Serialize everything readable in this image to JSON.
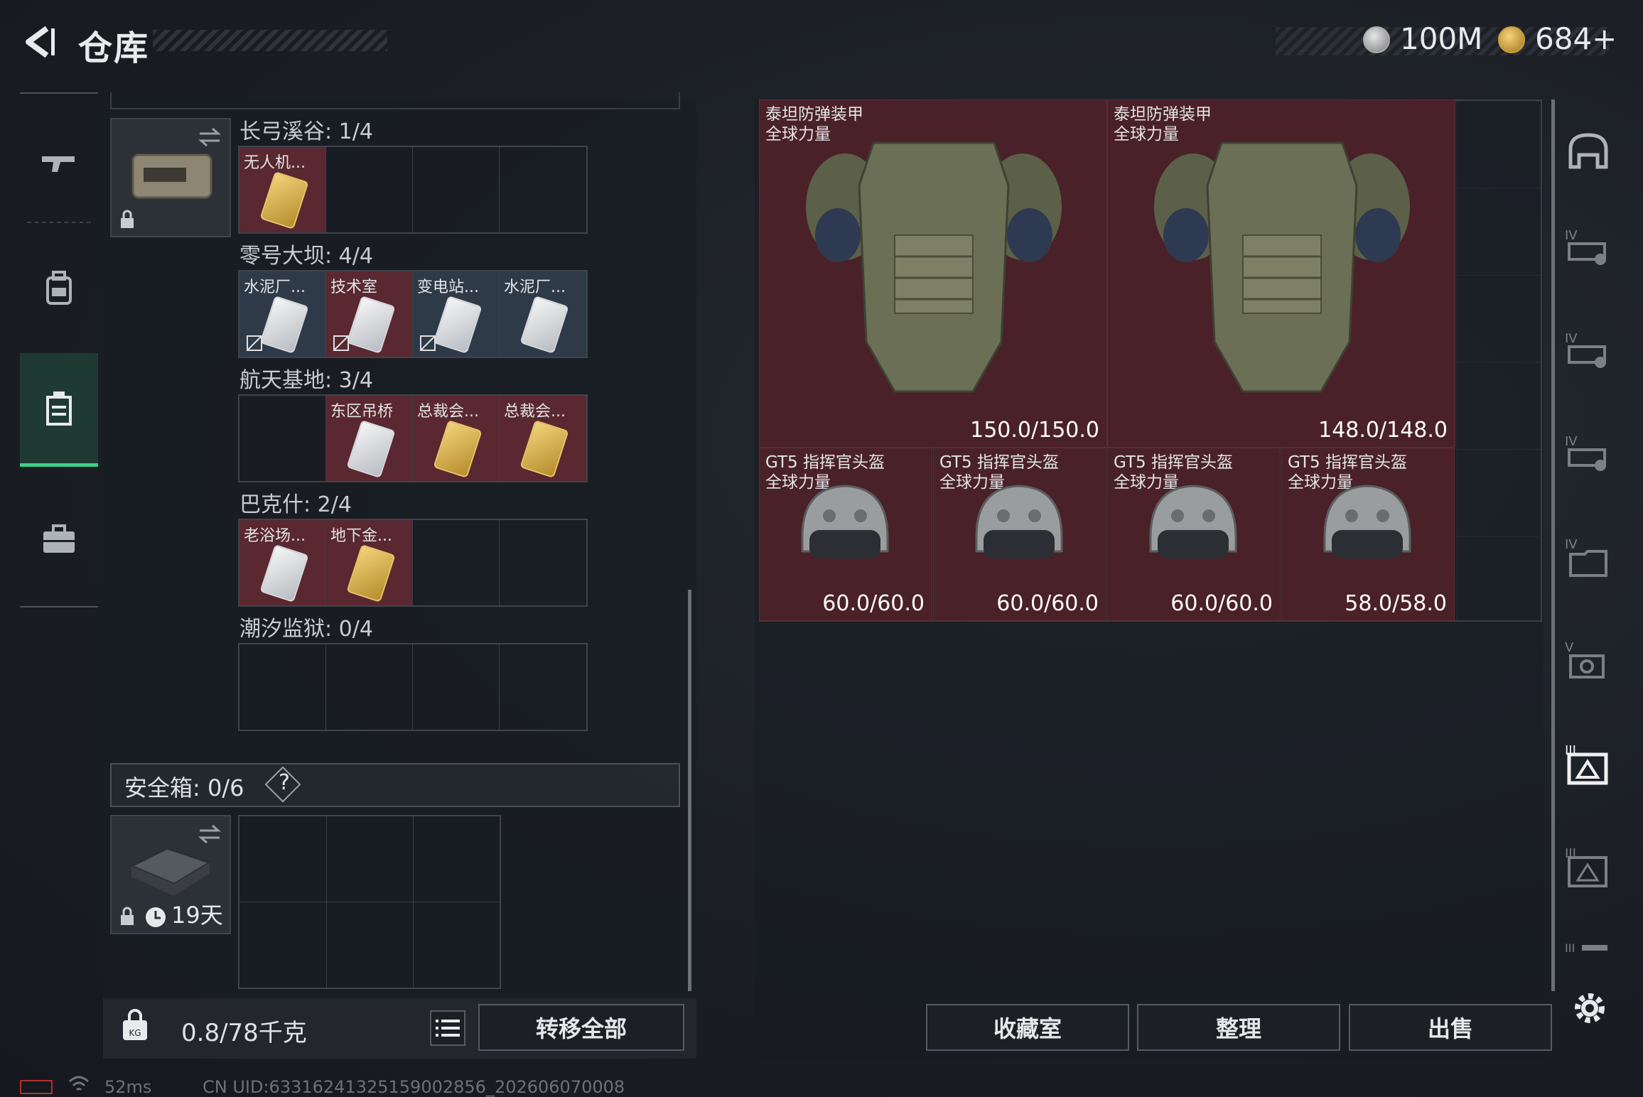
{
  "header": {
    "title": "仓库",
    "currency1": "100M",
    "currency2": "684+"
  },
  "nav": {
    "items": [
      "weapon-icon",
      "gear-icon",
      "container-icon",
      "briefcase-icon"
    ],
    "active": 2
  },
  "container": {
    "sections": [
      {
        "label": "长弓溪谷: 1/4",
        "slots": [
          {
            "name": "无人机...",
            "card": "gold"
          },
          null,
          null,
          null
        ]
      },
      {
        "label": "零号大坝: 4/4",
        "slots": [
          {
            "name": "水泥厂...",
            "card": "silver",
            "blocked": true
          },
          {
            "name": "技术室",
            "card": "silver",
            "blocked": true
          },
          {
            "name": "变电站...",
            "card": "silver",
            "blocked": true,
            "tone": "blue"
          },
          {
            "name": "水泥厂...",
            "card": "silver"
          }
        ]
      },
      {
        "label": "航天基地: 3/4",
        "slots": [
          null,
          {
            "name": "东区吊桥",
            "card": "silver"
          },
          {
            "name": "总裁会...",
            "card": "gold"
          },
          {
            "name": "总裁会...",
            "card": "gold"
          }
        ]
      },
      {
        "label": "巴克什: 2/4",
        "slots": [
          {
            "name": "老浴场...",
            "card": "silver"
          },
          {
            "name": "地下金...",
            "card": "gold"
          },
          null,
          null
        ]
      },
      {
        "label": "潮汐监狱: 0/4",
        "slots": [
          null,
          null,
          null,
          null
        ]
      }
    ]
  },
  "safebox": {
    "label": "安全箱: 0/6",
    "help": "?",
    "timer": "19天"
  },
  "bottom_left": {
    "weight": "0.8/78千克",
    "transfer_label": "转移全部"
  },
  "items": {
    "armors": [
      {
        "name1": "泰坦防弹装甲",
        "name2": "全球力量",
        "durability": "150.0/150.0"
      },
      {
        "name1": "泰坦防弹装甲",
        "name2": "全球力量",
        "durability": "148.0/148.0"
      }
    ],
    "helmets": [
      {
        "name1": "GT5 指挥官头盔",
        "name2": "全球力量",
        "durability": "60.0/60.0"
      },
      {
        "name1": "GT5 指挥官头盔",
        "name2": "全球力量",
        "durability": "60.0/60.0"
      },
      {
        "name1": "GT5 指挥官头盔",
        "name2": "全球力量",
        "durability": "60.0/60.0"
      },
      {
        "name1": "GT5 指挥官头盔",
        "name2": "全球力量",
        "durability": "58.0/58.0"
      }
    ]
  },
  "bottom_right": {
    "collection_label": "收藏室",
    "sort_label": "整理",
    "sell_label": "出售"
  },
  "footer": {
    "ping": "52ms",
    "uid": "CN UID:63316241325159002856_202606070008"
  }
}
